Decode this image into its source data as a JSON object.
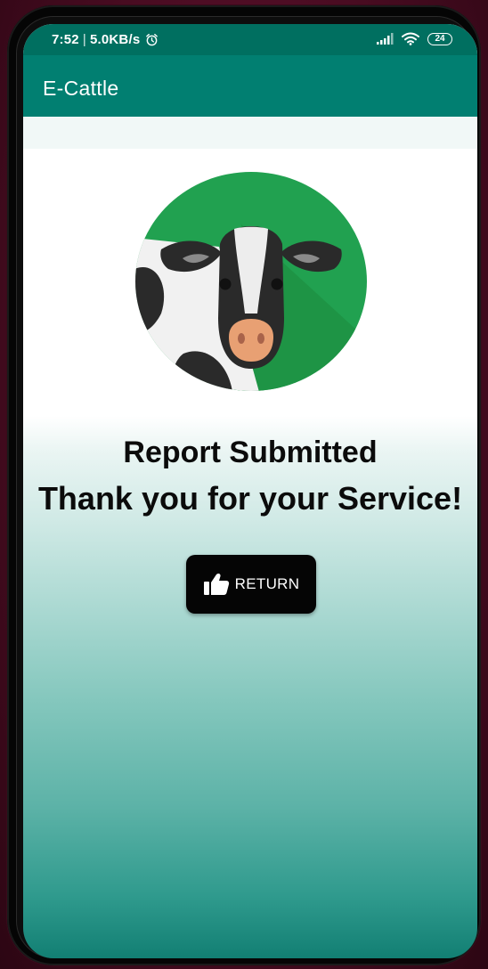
{
  "status_bar": {
    "time": "7:52",
    "separator": "|",
    "net_speed": "5.0KB/s",
    "battery": "24",
    "icons": [
      "alarm-icon",
      "signal-icon",
      "wifi-icon",
      "battery-icon"
    ]
  },
  "app_bar": {
    "title": "E-Cattle"
  },
  "logo": {
    "icon": "cow-logo-icon",
    "colors": {
      "circle": "#21a150",
      "dark": "#1e9445"
    }
  },
  "message": {
    "line1": "Report Submitted",
    "line2": "Thank you for your Service!"
  },
  "return_button": {
    "label": "RETURN",
    "icon": "thumbs-up-icon"
  },
  "colors": {
    "status_bar": "#006f60",
    "app_bar": "#017f71",
    "accent_bottom": "#127f73",
    "button": "#050505"
  }
}
